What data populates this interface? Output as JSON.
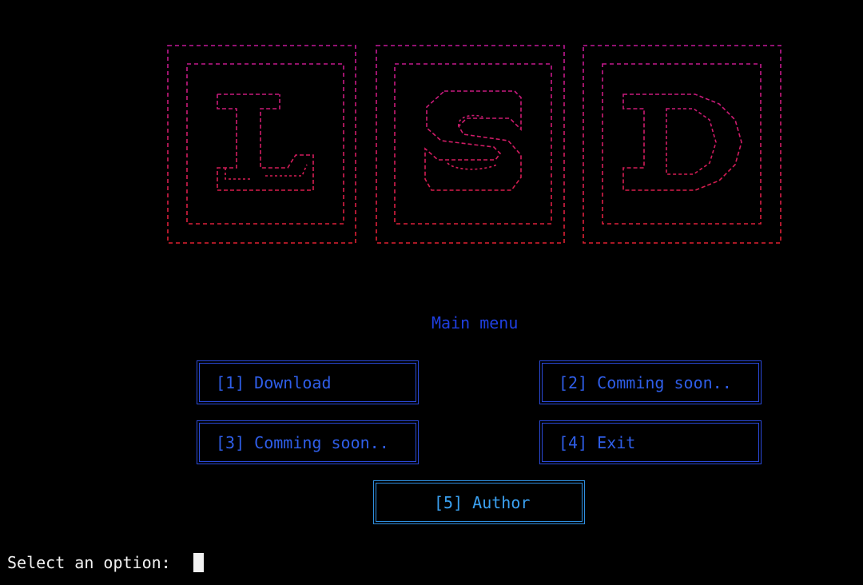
{
  "logo": {
    "letters": [
      "L",
      "S",
      "D"
    ],
    "colors": {
      "top": "#c0189a",
      "bottom": "#e0202e"
    }
  },
  "menu": {
    "title": "Main menu",
    "items": [
      {
        "label": "[1] Download"
      },
      {
        "label": "[2] Comming soon.."
      },
      {
        "label": "[3] Comming soon.."
      },
      {
        "label": "[4] Exit"
      },
      {
        "label": "[5] Author"
      }
    ]
  },
  "prompt": {
    "text": "Select an option: "
  },
  "colors": {
    "background": "#000000",
    "menu_text": "#2f5ee8",
    "menu_border": "#2a49d8",
    "author_text": "#3aa0f0",
    "prompt_text": "#f2f2f2"
  }
}
